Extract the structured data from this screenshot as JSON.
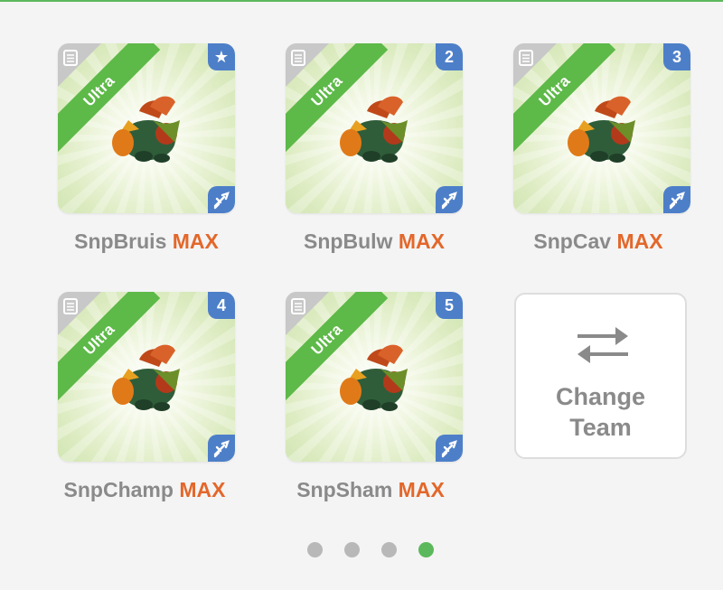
{
  "cards": [
    {
      "tier": "Ultra",
      "badge": "★",
      "name": "SnpBruis",
      "level": "MAX"
    },
    {
      "tier": "Ultra",
      "badge": "2",
      "name": "SnpBulw",
      "level": "MAX"
    },
    {
      "tier": "Ultra",
      "badge": "3",
      "name": "SnpCav",
      "level": "MAX"
    },
    {
      "tier": "Ultra",
      "badge": "4",
      "name": "SnpChamp",
      "level": "MAX"
    },
    {
      "tier": "Ultra",
      "badge": "5",
      "name": "SnpSham",
      "level": "MAX"
    }
  ],
  "change_team": {
    "line1": "Change",
    "line2": "Team",
    "icon": "swap-arrows-icon"
  },
  "pagination": {
    "pages": 4,
    "current": 4
  },
  "colors": {
    "accent_green": "#5cb85c",
    "ribbon_green": "#5db948",
    "badge_blue": "#4d7fc9",
    "max_orange": "#e3672a",
    "name_gray": "#8a8a8a"
  }
}
